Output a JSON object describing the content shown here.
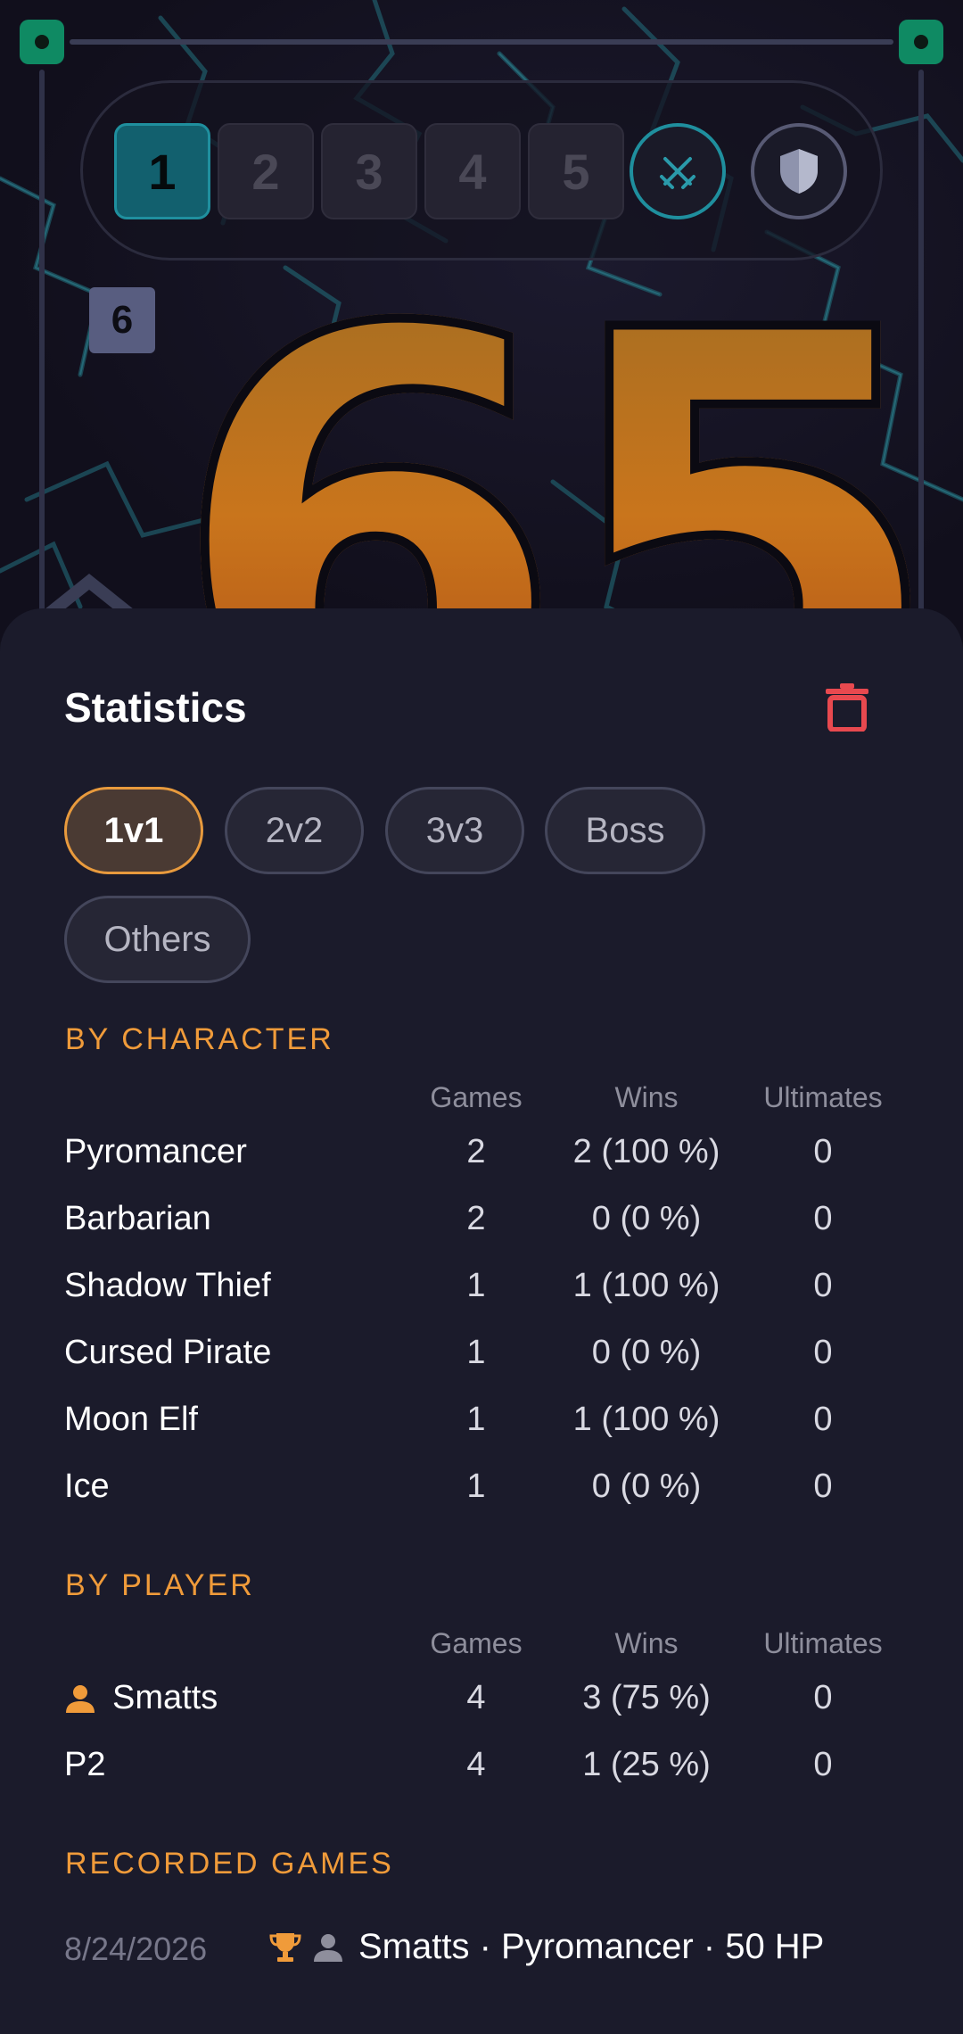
{
  "game": {
    "rounds": [
      "1",
      "2",
      "3",
      "4",
      "5"
    ],
    "active_round": "1",
    "level_badge": "6",
    "life_total": "65",
    "colors": {
      "accent_teal": "#1f8f9e",
      "corner_green": "#0f8a63",
      "life_orange": "#c9751c"
    },
    "icons": [
      "sword-icon",
      "shield-icon",
      "corner-handle-icon"
    ]
  },
  "stats": {
    "title": "Statistics",
    "delete_icon": "trash-icon",
    "filters": [
      "1v1",
      "2v2",
      "3v3",
      "Boss",
      "Others"
    ],
    "selected_filter": "1v1",
    "by_character": {
      "title": "BY CHARACTER",
      "headers": [
        "Games",
        "Wins",
        "Ultimates"
      ],
      "rows": [
        {
          "name": "Pyromancer",
          "games": "2",
          "wins": "2 (100 %)",
          "ultimates": "0"
        },
        {
          "name": "Barbarian",
          "games": "2",
          "wins": "0 (0 %)",
          "ultimates": "0"
        },
        {
          "name": "Shadow Thief",
          "games": "1",
          "wins": "1 (100 %)",
          "ultimates": "0"
        },
        {
          "name": "Cursed Pirate",
          "games": "1",
          "wins": "0 (0 %)",
          "ultimates": "0"
        },
        {
          "name": "Moon Elf",
          "games": "1",
          "wins": "1 (100 %)",
          "ultimates": "0"
        },
        {
          "name": "Ice",
          "games": "1",
          "wins": "0 (0 %)",
          "ultimates": "0"
        }
      ]
    },
    "by_player": {
      "title": "BY PLAYER",
      "headers": [
        "Games",
        "Wins",
        "Ultimates"
      ],
      "rows": [
        {
          "name": "Smatts",
          "icon": "person-icon",
          "games": "4",
          "wins": "3 (75 %)",
          "ultimates": "0"
        },
        {
          "name": "P2",
          "games": "4",
          "wins": "1 (25 %)",
          "ultimates": "0"
        }
      ]
    },
    "recorded_games": {
      "title": "RECORDED GAMES",
      "items": [
        {
          "date": "8/24/2026",
          "icons": [
            "trophy-icon",
            "person-icon"
          ],
          "summary": "Smatts · Pyromancer · 50 HP"
        }
      ]
    }
  }
}
